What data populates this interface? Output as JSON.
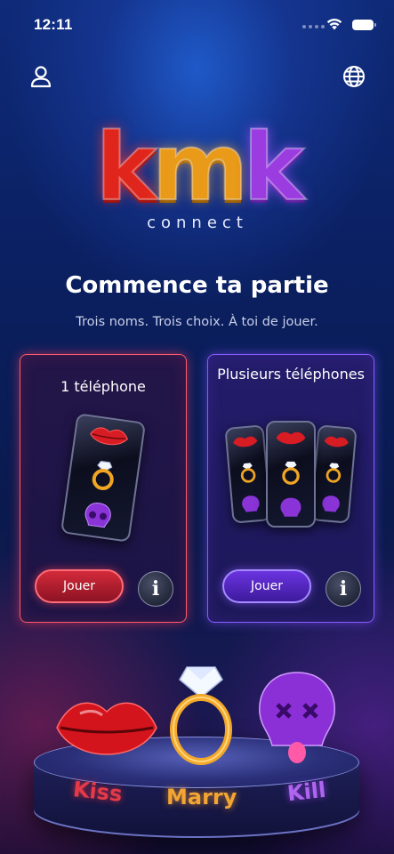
{
  "status_bar": {
    "time": "12:11"
  },
  "header": {
    "profile_icon": "person-icon",
    "language_icon": "globe-icon"
  },
  "logo": {
    "letters": [
      "k",
      "m",
      "k"
    ],
    "subtitle": "connect"
  },
  "main": {
    "title": "Commence ta partie",
    "subtitle": "Trois noms. Trois choix. À toi de jouer."
  },
  "cards": [
    {
      "title": "1 téléphone",
      "play_label": "Jouer",
      "info_label": "i",
      "accent": "#ff5a6a"
    },
    {
      "title": "Plusieurs téléphones",
      "play_label": "Jouer",
      "info_label": "i",
      "accent": "#8a5cff"
    }
  ],
  "stage": {
    "kiss": "Kiss",
    "marry": "Marry",
    "kill": "Kill"
  },
  "colors": {
    "red": "#e0261c",
    "gold": "#e89a18",
    "purple": "#9a3ce0"
  }
}
